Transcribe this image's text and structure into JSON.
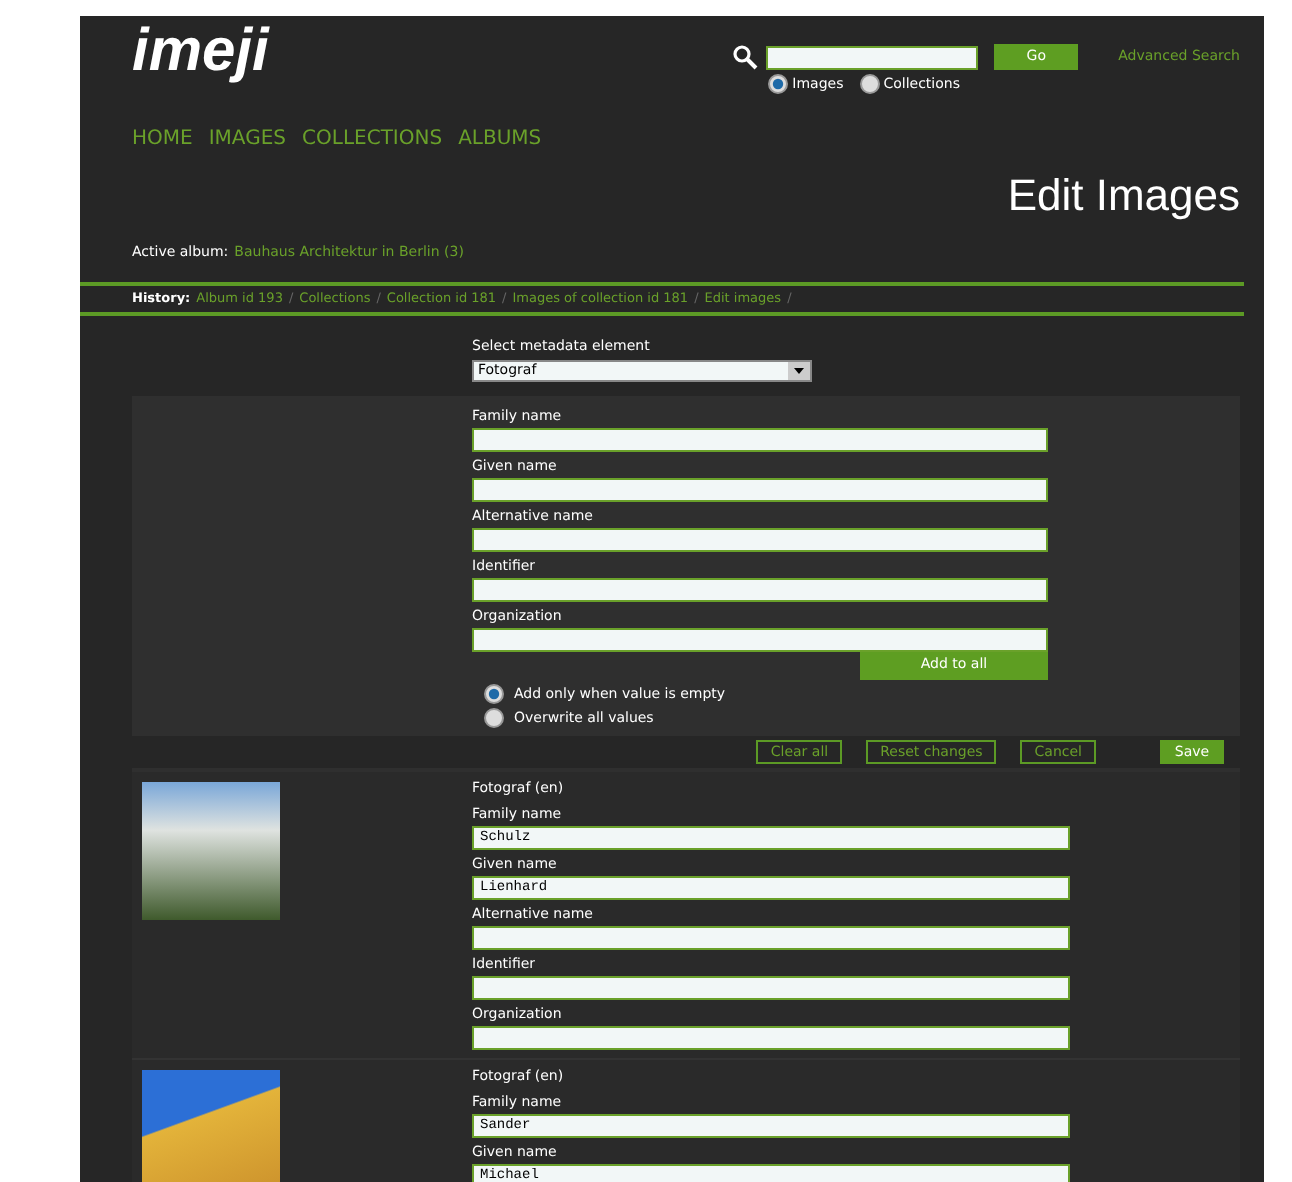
{
  "header": {
    "logo": "imeji",
    "search": {
      "button": "Go",
      "advanced": "Advanced Search",
      "scopes": [
        {
          "label": "Images",
          "selected": true
        },
        {
          "label": "Collections",
          "selected": false
        }
      ]
    }
  },
  "nav": [
    "HOME",
    "IMAGES",
    "COLLECTIONS",
    "ALBUMS"
  ],
  "title": "Edit Images",
  "active_album": {
    "label": "Active album:",
    "value": "Bauhaus Architektur in Berlin (3)"
  },
  "history": {
    "label": "History:",
    "separator": "/",
    "items": [
      "Album id 193",
      "Collections",
      "Collection id 181",
      "Images of collection id 181",
      "Edit images"
    ]
  },
  "metadata_select": {
    "label": "Select metadata element",
    "value": "Fotograf"
  },
  "bulk_form": {
    "fields": [
      "Family name",
      "Given name",
      "Alternative name",
      "Identifier",
      "Organization"
    ],
    "add_button": "Add to all",
    "modes": [
      {
        "label": "Add only when value is empty",
        "selected": true
      },
      {
        "label": "Overwrite all values",
        "selected": false
      }
    ]
  },
  "actions": [
    {
      "label": "Clear all",
      "kind": "secondary"
    },
    {
      "label": "Reset changes",
      "kind": "secondary"
    },
    {
      "label": "Cancel",
      "kind": "secondary"
    },
    {
      "label": "Save",
      "kind": "primary"
    }
  ],
  "images": [
    {
      "heading": "Fotograf (en)",
      "fields": [
        {
          "label": "Family name",
          "value": "Schulz"
        },
        {
          "label": "Given name",
          "value": "Lienhard"
        },
        {
          "label": "Alternative name"
        },
        {
          "label": "Identifier"
        },
        {
          "label": "Organization"
        }
      ]
    },
    {
      "heading": "Fotograf (en)",
      "fields": [
        {
          "label": "Family name",
          "value": "Sander"
        },
        {
          "label": "Given name",
          "value": "Michael"
        }
      ]
    }
  ]
}
